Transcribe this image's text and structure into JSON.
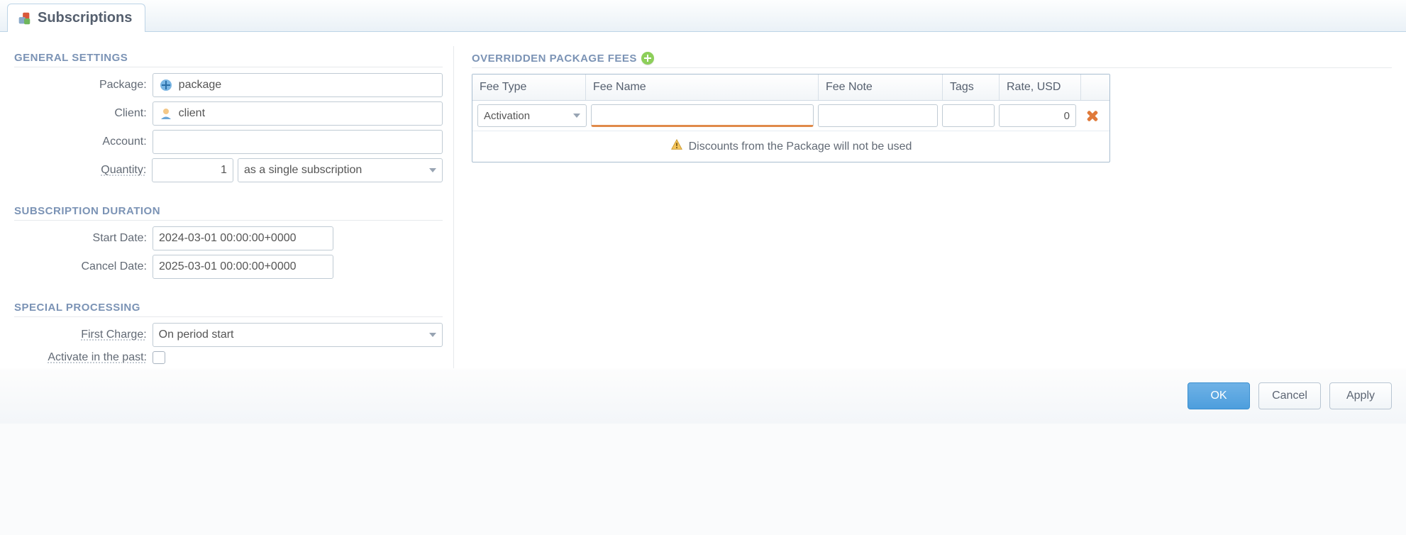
{
  "tab": {
    "title": "Subscriptions"
  },
  "sections": {
    "general": {
      "title": "GENERAL SETTINGS",
      "package_label": "Package:",
      "package_value": "package",
      "client_label": "Client:",
      "client_value": "client",
      "account_label": "Account:",
      "account_value": "",
      "quantity_label": "Quantity:",
      "quantity_value": "1",
      "quantity_mode": "as a single subscription"
    },
    "duration": {
      "title": "SUBSCRIPTION DURATION",
      "start_label": "Start Date:",
      "start_value": "2024-03-01 00:00:00+0000",
      "cancel_label": "Cancel Date:",
      "cancel_value": "2025-03-01 00:00:00+0000"
    },
    "special": {
      "title": "SPECIAL PROCESSING",
      "first_charge_label": "First Charge:",
      "first_charge_value": "On period start",
      "activate_past_label": "Activate in the past:"
    }
  },
  "fees": {
    "title": "OVERRIDDEN PACKAGE FEES",
    "columns": {
      "fee_type": "Fee Type",
      "fee_name": "Fee Name",
      "fee_note": "Fee Note",
      "tags": "Tags",
      "rate": "Rate, USD"
    },
    "rows": [
      {
        "fee_type": "Activation",
        "fee_name": "",
        "fee_note": "",
        "tags": "",
        "rate": "0"
      }
    ],
    "warning": "Discounts from the Package will not be used"
  },
  "footer": {
    "ok": "OK",
    "cancel": "Cancel",
    "apply": "Apply"
  }
}
